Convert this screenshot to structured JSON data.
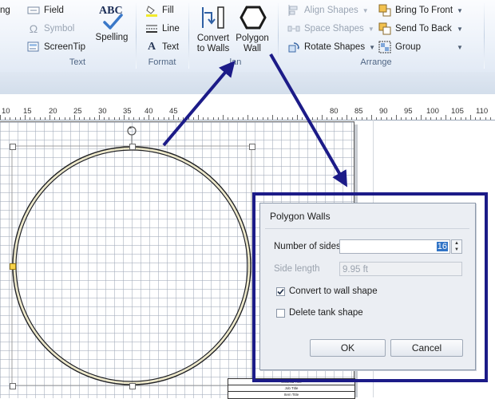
{
  "ribbon": {
    "text_group": {
      "field_label": "Field",
      "symbol_label": "Symbol",
      "screentip_label": "ScreenTip",
      "group_label": "Text",
      "cut_text": "ng"
    },
    "spelling": {
      "abc": "ABC",
      "label": "Spelling"
    },
    "format_group": {
      "fill_label": "Fill",
      "line_label": "Line",
      "text_label": "Text",
      "text_glyph": "A",
      "group_label": "Format"
    },
    "plan_group": {
      "convert_line1": "Convert",
      "convert_line2": "to Walls",
      "polygon_line1": "Polygon",
      "polygon_line2": "Wall",
      "group_label_fragment": "lan"
    },
    "arrange_group": {
      "align_label": "Align Shapes",
      "space_label": "Space Shapes",
      "rotate_label": "Rotate Shapes",
      "bring_front_label": "Bring To Front",
      "send_back_label": "Send To Back",
      "group_btn_label": "Group",
      "group_label": "Arrange"
    }
  },
  "ruler": {
    "left_fragment": "10",
    "ticks": [
      "15",
      "20",
      "25",
      "30",
      "35",
      "40",
      "45"
    ],
    "right_ticks": [
      "80",
      "85",
      "90",
      "95",
      "100",
      "105",
      "110"
    ]
  },
  "title_block": {
    "rows": [
      "Scaffold Title",
      "Job Title",
      "Item Title"
    ]
  },
  "dialog": {
    "title": "Polygon Walls",
    "sides_label": "Number of sides",
    "sides_value": "16",
    "side_length_label": "Side length",
    "side_length_value": "9.95 ft",
    "convert_label": "Convert to wall shape",
    "convert_checked": true,
    "delete_label": "Delete tank shape",
    "delete_checked": false,
    "ok_label": "OK",
    "cancel_label": "Cancel"
  },
  "colors": {
    "highlight_frame": "#1c1b88",
    "arrow": "#1c1b88",
    "ribbon_group_label": "#4f6584",
    "selection": "#3174c6"
  }
}
